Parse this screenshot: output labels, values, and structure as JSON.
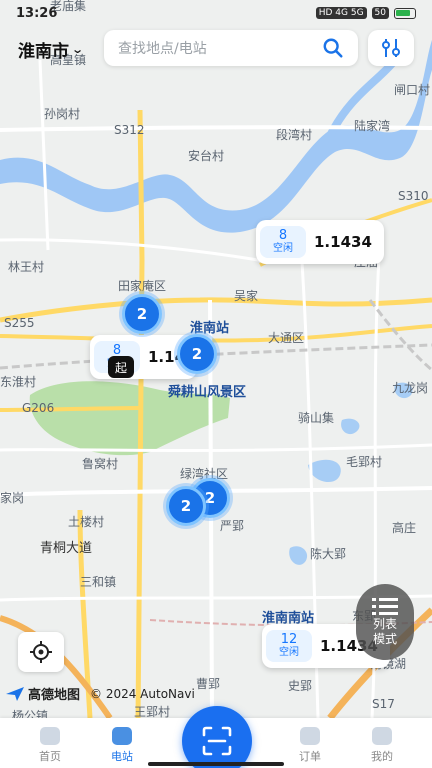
{
  "status_bar": {
    "time": "13:26",
    "icons": "HD 4G 5G",
    "battery": "50"
  },
  "header": {
    "city": "淮南市",
    "search_placeholder": "查找地点/电站"
  },
  "map": {
    "labels": [
      "老庙集",
      "田家庵区",
      "高皇镇",
      "孙岗村",
      "S312",
      "安台村",
      "段湾村",
      "陆家湾",
      "闸口村",
      "S310",
      "林王村",
      "吴家",
      "庄庙",
      "S255",
      "大通区",
      "淮南站",
      "东淮村",
      "舜耕山风景区",
      "九龙岗",
      "G206",
      "骑山集",
      "鲁窝村",
      "绿湾社区",
      "毛郢村",
      "家岗",
      "土楼村",
      "严郢",
      "高庄",
      "陈大郢",
      "青桐大道",
      "三和镇",
      "淮南南站",
      "东郢",
      "曹郢",
      "史郢",
      "南镜湖",
      "王郢村",
      "杨公镇",
      "S17",
      "龟山"
    ],
    "stations": [
      {
        "free": "8",
        "free_label": "空闲",
        "price": "1.1434"
      },
      {
        "free": "8",
        "free_label": "空闲",
        "price": "1.14"
      },
      {
        "free": "12",
        "free_label": "空闲",
        "price": "1.1434"
      }
    ],
    "clusters": [
      "2",
      "2",
      "2",
      "2"
    ],
    "start_marker": "起"
  },
  "controls": {
    "list_mode": "列表模式"
  },
  "attribution": {
    "brand": "高德地图",
    "copyright": "© 2024 AutoNavi"
  },
  "tabs": [
    {
      "label": "首页"
    },
    {
      "label": "电站"
    },
    {
      "label": "订单"
    },
    {
      "label": "我的"
    }
  ],
  "colors": {
    "accent": "#1a73e8",
    "road_major": "#ffd966",
    "water": "#9fc7f5",
    "park": "#b9dfa9"
  }
}
